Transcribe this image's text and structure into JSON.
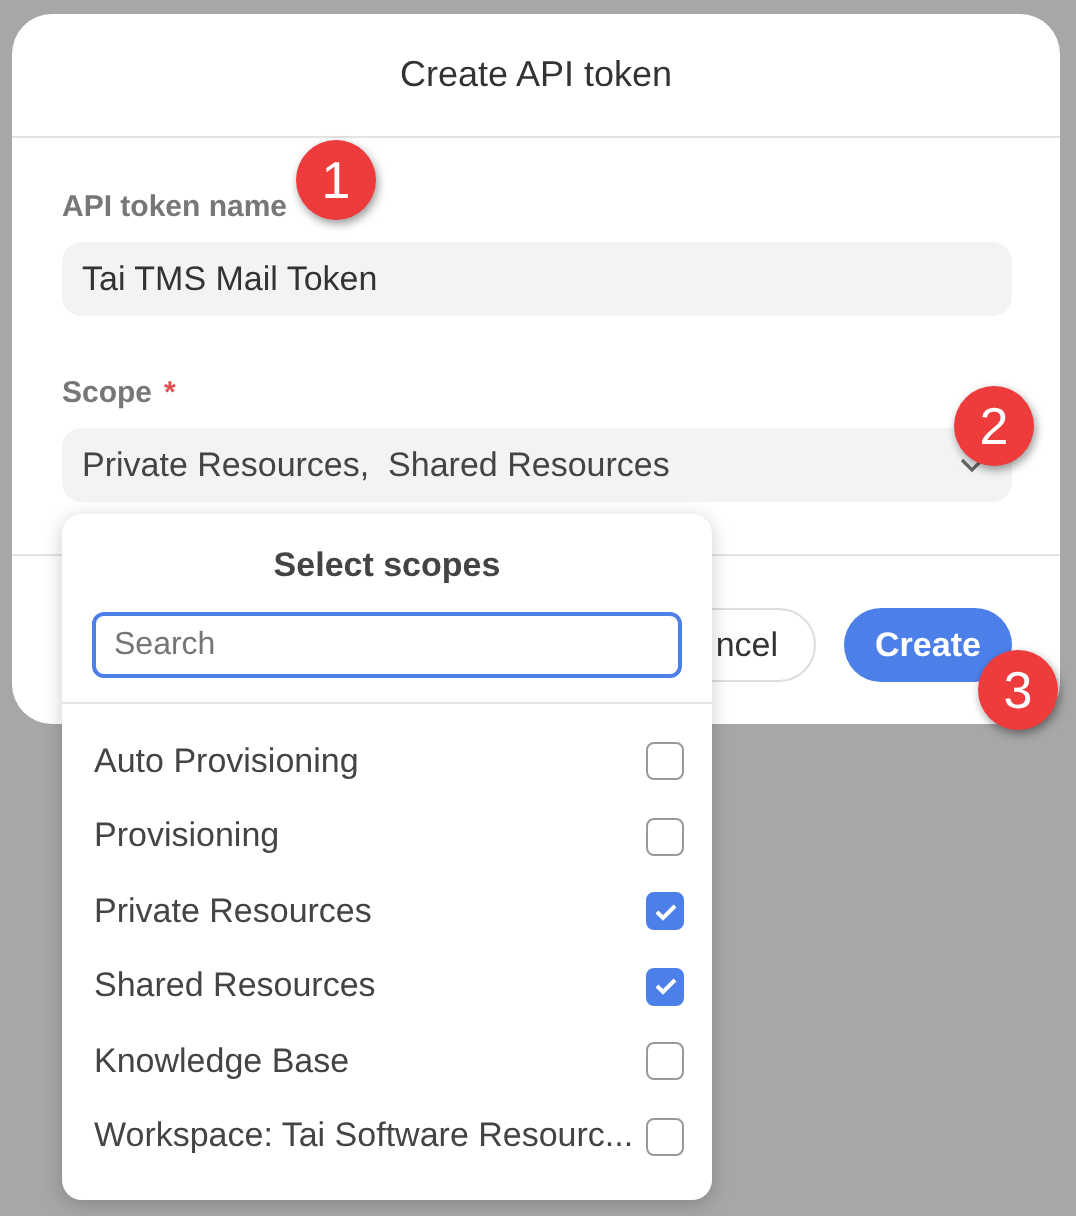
{
  "dialog": {
    "title": "Create API token",
    "name_field": {
      "label": "API token name",
      "value": "Tai TMS Mail Token"
    },
    "scope_field": {
      "label": "Scope",
      "required_mark": "*",
      "value": "Private Resources,  Shared Resources"
    },
    "buttons": [
      {
        "label": "ncel",
        "kind": "secondary"
      },
      {
        "label": "Create",
        "kind": "primary"
      }
    ]
  },
  "scope_popover": {
    "title": "Select scopes",
    "search": {
      "placeholder": "Search"
    },
    "options": [
      {
        "label": "Auto Provisioning",
        "checked": false
      },
      {
        "label": "Provisioning",
        "checked": false
      },
      {
        "label": "Private Resources",
        "checked": true
      },
      {
        "label": "Shared Resources",
        "checked": true
      },
      {
        "label": "Knowledge Base",
        "checked": false
      },
      {
        "label": "Workspace: Tai Software Resourc...",
        "checked": false
      }
    ]
  },
  "step_badges": [
    "1",
    "2",
    "3"
  ]
}
